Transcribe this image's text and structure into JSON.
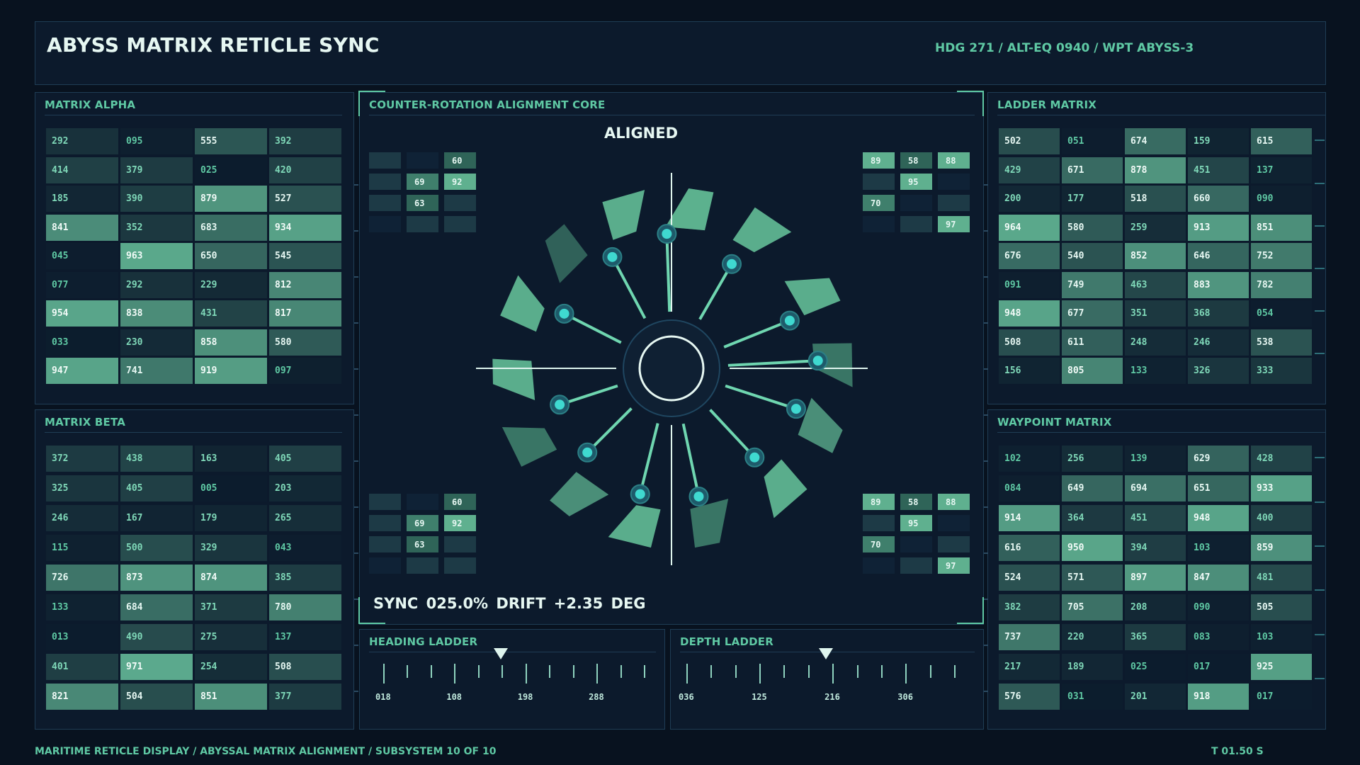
{
  "header": {
    "title": "ABYSS MATRIX RETICLE SYNC",
    "nav_status": "HDG 271 / ALT-EQ 0940 / WPT ABYSS-3"
  },
  "matrix_alpha": {
    "title": "MATRIX ALPHA",
    "rows": [
      [
        "292",
        "095",
        "555",
        "392"
      ],
      [
        "414",
        "379",
        "025",
        "420"
      ],
      [
        "185",
        "390",
        "879",
        "527"
      ],
      [
        "841",
        "352",
        "683",
        "934"
      ],
      [
        "045",
        "963",
        "650",
        "545"
      ],
      [
        "077",
        "292",
        "229",
        "812"
      ],
      [
        "954",
        "838",
        "431",
        "817"
      ],
      [
        "033",
        "230",
        "858",
        "580"
      ],
      [
        "947",
        "741",
        "919",
        "097"
      ]
    ]
  },
  "matrix_beta": {
    "title": "MATRIX BETA",
    "rows": [
      [
        "372",
        "438",
        "163",
        "405"
      ],
      [
        "325",
        "405",
        "005",
        "203"
      ],
      [
        "246",
        "167",
        "179",
        "265"
      ],
      [
        "115",
        "500",
        "329",
        "043"
      ],
      [
        "726",
        "873",
        "874",
        "385"
      ],
      [
        "133",
        "684",
        "371",
        "780"
      ],
      [
        "013",
        "490",
        "275",
        "137"
      ],
      [
        "401",
        "971",
        "254",
        "508"
      ],
      [
        "821",
        "504",
        "851",
        "377"
      ]
    ]
  },
  "ladder_matrix": {
    "title": "LADDER MATRIX",
    "rows": [
      [
        "502",
        "051",
        "674",
        "159",
        "615"
      ],
      [
        "429",
        "671",
        "878",
        "451",
        "137"
      ],
      [
        "200",
        "177",
        "518",
        "660",
        "090"
      ],
      [
        "964",
        "580",
        "259",
        "913",
        "851"
      ],
      [
        "676",
        "540",
        "852",
        "646",
        "752"
      ],
      [
        "091",
        "749",
        "463",
        "883",
        "782"
      ],
      [
        "948",
        "677",
        "351",
        "368",
        "054"
      ],
      [
        "508",
        "611",
        "248",
        "246",
        "538"
      ],
      [
        "156",
        "805",
        "133",
        "326",
        "333"
      ]
    ]
  },
  "waypoint_matrix": {
    "title": "WAYPOINT MATRIX",
    "rows": [
      [
        "102",
        "256",
        "139",
        "629",
        "428"
      ],
      [
        "084",
        "649",
        "694",
        "651",
        "933"
      ],
      [
        "914",
        "364",
        "451",
        "948",
        "400"
      ],
      [
        "616",
        "950",
        "394",
        "103",
        "859"
      ],
      [
        "524",
        "571",
        "897",
        "847",
        "481"
      ],
      [
        "382",
        "705",
        "208",
        "090",
        "505"
      ],
      [
        "737",
        "220",
        "365",
        "083",
        "103"
      ],
      [
        "217",
        "189",
        "025",
        "017",
        "925"
      ],
      [
        "576",
        "031",
        "201",
        "918",
        "017"
      ]
    ]
  },
  "core": {
    "title": "COUNTER-ROTATION ALIGNMENT CORE",
    "status": "ALIGNED",
    "sync_readout": "SYNC 025.0%   DRIFT +2.35 DEG",
    "mini_left": [
      "",
      "",
      "60",
      "",
      "69",
      "92",
      "",
      "63",
      "",
      "",
      "",
      ""
    ],
    "mini_right": [
      "89",
      "58",
      "88",
      "",
      "95",
      "",
      "70",
      "",
      "",
      "",
      "",
      "97"
    ]
  },
  "heading_ladder": {
    "title": "HEADING LADDER",
    "labels": [
      "018",
      "108",
      "198",
      "288"
    ],
    "marker_fraction": 0.45
  },
  "depth_ladder": {
    "title": "DEPTH LADDER",
    "labels": [
      "036",
      "125",
      "216",
      "306"
    ],
    "marker_fraction": 0.52
  },
  "footer": {
    "left": "MARITIME RETICLE DISPLAY / ABYSSAL MATRIX ALIGNMENT / SUBSYSTEM 10 OF 10",
    "right": "T 01.50 S"
  },
  "colors": {
    "accent": "#5fc9a4",
    "bright": "#e6f7f2",
    "panel": "#0c1a2c",
    "border": "#1f3d55",
    "node": "#3fd9d0"
  }
}
